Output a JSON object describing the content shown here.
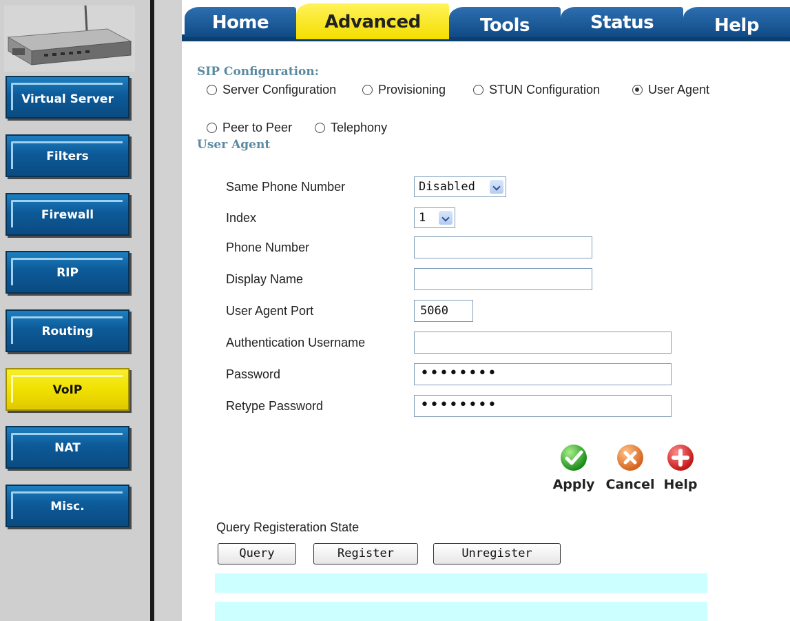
{
  "nav": {
    "items": [
      {
        "label": "Virtual Server",
        "active": false
      },
      {
        "label": "Filters",
        "active": false
      },
      {
        "label": "Firewall",
        "active": false
      },
      {
        "label": "RIP",
        "active": false
      },
      {
        "label": "Routing",
        "active": false
      },
      {
        "label": "VoIP",
        "active": true
      },
      {
        "label": "NAT",
        "active": false
      },
      {
        "label": "Misc.",
        "active": false
      }
    ]
  },
  "tabs": [
    {
      "label": "Home",
      "active": false
    },
    {
      "label": "Advanced",
      "active": true
    },
    {
      "label": "Tools",
      "active": false
    },
    {
      "label": "Status",
      "active": false
    },
    {
      "label": "Help",
      "active": false
    }
  ],
  "sip": {
    "heading": "SIP Configuration:",
    "options": [
      {
        "label": "Server Configuration",
        "selected": false
      },
      {
        "label": "Provisioning",
        "selected": false
      },
      {
        "label": "STUN Configuration",
        "selected": false
      },
      {
        "label": "User Agent",
        "selected": true
      },
      {
        "label": "Peer to Peer",
        "selected": false
      },
      {
        "label": "Telephony",
        "selected": false
      }
    ]
  },
  "user_agent": {
    "heading": "User Agent",
    "fields": {
      "same_phone": {
        "label": "Same Phone Number",
        "value": "Disabled"
      },
      "index": {
        "label": "Index",
        "value": "1"
      },
      "phone_number": {
        "label": "Phone Number",
        "value": ""
      },
      "display_name": {
        "label": "Display Name",
        "value": ""
      },
      "ua_port": {
        "label": "User Agent Port",
        "value": "5060"
      },
      "auth_user": {
        "label": "Authentication Username",
        "value": ""
      },
      "password": {
        "label": "Password",
        "value": "••••••••"
      },
      "retype_password": {
        "label": "Retype Password",
        "value": "••••••••"
      }
    }
  },
  "actions": {
    "apply": "Apply",
    "cancel": "Cancel",
    "help": "Help"
  },
  "query": {
    "label": "Query Registeration State",
    "buttons": {
      "query": "Query",
      "register": "Register",
      "unregister": "Unregister"
    }
  },
  "colors": {
    "nav_blue": "#0d5a98",
    "active_yellow": "#f0e000",
    "section_heading": "#5a8aa0",
    "status_bar": "#ccffff",
    "apply_green": "#2aa52a",
    "cancel_orange": "#e8742a",
    "help_red": "#d81e1e"
  }
}
